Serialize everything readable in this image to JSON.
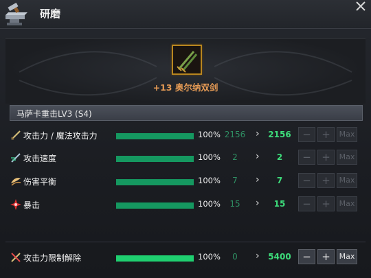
{
  "title": "研磨",
  "item": {
    "name": "+13 奥尔纳双剑"
  },
  "section": {
    "label": "马萨卡重击LV3 (S4)"
  },
  "stats": [
    {
      "icon": "sword-icon",
      "label": "攻击力 / 魔法攻击力",
      "percent": "100%",
      "fill": 1.0,
      "current": "2156",
      "next": "2156"
    },
    {
      "icon": "speed-sword-icon",
      "label": "攻击速度",
      "percent": "100%",
      "fill": 1.0,
      "current": "2",
      "next": "2"
    },
    {
      "icon": "wing-icon",
      "label": "伤害平衡",
      "percent": "100%",
      "fill": 1.0,
      "current": "7",
      "next": "7"
    },
    {
      "icon": "critical-burst-icon",
      "label": "暴击",
      "percent": "100%",
      "fill": 1.0,
      "current": "15",
      "next": "15"
    }
  ],
  "limit": {
    "icon": "limit-break-icon",
    "label": "攻击力限制解除",
    "percent": "100%",
    "fill": 1.0,
    "current": "0",
    "next": "5400"
  },
  "buttons": {
    "minus": "−",
    "plus": "+",
    "max": "Max"
  },
  "arrow": "›",
  "colors": {
    "accent_orange": "#e49a55",
    "bar_green": "#159860",
    "value_green": "#3ddc7a",
    "frame_gold": "#b8861f"
  }
}
